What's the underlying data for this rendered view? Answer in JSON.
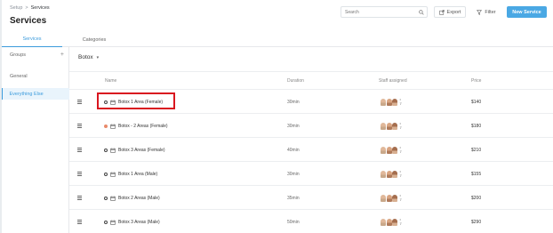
{
  "breadcrumb": {
    "parent": "Setup",
    "separator": ">",
    "current": "Services"
  },
  "page_title": "Services",
  "search": {
    "placeholder": "Search"
  },
  "toolbar": {
    "export_label": "Export",
    "filter_label": "Filter",
    "new_label": "New Service"
  },
  "tabs": [
    {
      "label": "Services",
      "active": true
    },
    {
      "label": "Categories",
      "active": false
    }
  ],
  "sidebar": {
    "groups_label": "Groups",
    "add_symbol": "+",
    "items": [
      {
        "label": "General"
      },
      {
        "label": "Everything Else",
        "active": true
      }
    ]
  },
  "category_filter": {
    "value": "Botox",
    "chevron": "▾"
  },
  "table": {
    "headers": {
      "name": "Name",
      "duration": "Duration",
      "staff": "Staff assigned",
      "price": "Price"
    },
    "rows": [
      {
        "name": "Botox 1 Area (Female)",
        "duration": "30min",
        "price": "$140",
        "status_color": "#ffffff",
        "selected": true
      },
      {
        "name": "Botox - 2 Areas (Female)",
        "duration": "30min",
        "price": "$180",
        "status_color": "#e98a6b"
      },
      {
        "name": "Botox 3 Areas (Female)",
        "duration": "40min",
        "price": "$210",
        "status_color": "#ffffff"
      },
      {
        "name": "Botox 1 Area (Male)",
        "duration": "30min",
        "price": "$155",
        "status_color": "#ffffff"
      },
      {
        "name": "Botox 2 Areas (Male)",
        "duration": "35min",
        "price": "$200",
        "status_color": "#ffffff"
      },
      {
        "name": "Botox 3 Areas (Male)",
        "duration": "50min",
        "price": "$290",
        "status_color": "#ffffff"
      }
    ],
    "staff_more_top": "•",
    "staff_more_bottom": "7"
  },
  "colors": {
    "accent": "#3b9bdc",
    "primary_button": "#4aa8e4",
    "highlight": "#d9161f"
  }
}
